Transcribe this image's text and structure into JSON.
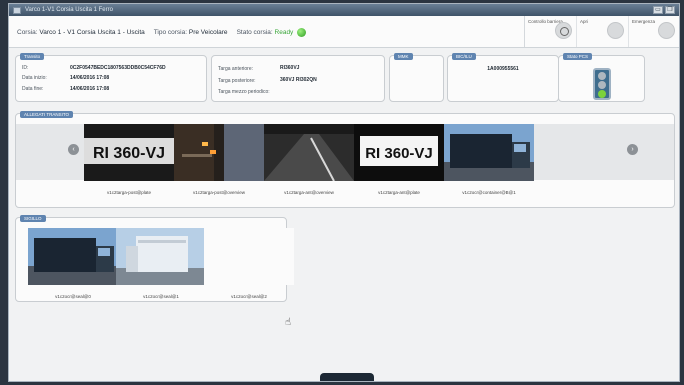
{
  "window": {
    "title": "Varco 1-V1 Corsia Uscita 1 Ferro",
    "min_icon": "minimize-icon",
    "max_icon": "maximize-icon",
    "min_glyph": "▭",
    "max_glyph": "❐"
  },
  "header": {
    "corsia_label": "Corsia:",
    "corsia_value": "Varco 1 - V1 Corsia Uscita 1 - Uscita",
    "tipo_label": "Tipo corsia:",
    "tipo_value": "Pre Veicolare",
    "stato_label": "Stato corsia:",
    "stato_value": "Ready",
    "stato_color": "#3aa63a",
    "controls": [
      {
        "label": "Controllo barriera"
      },
      {
        "label": "Apri"
      },
      {
        "label": "Emergenza"
      }
    ]
  },
  "transito": {
    "tag": "Transito",
    "id_label": "ID:",
    "id_value": "0C2F0547BEDC1807563DDB0C54CF76D",
    "inizio_label": "Data inizio:",
    "inizio_value": "14/06/2016 17:08",
    "fine_label": "Data fine:",
    "fine_value": "14/06/2016 17:08"
  },
  "targhe": {
    "anteriore_label": "Targa anteriore:",
    "anteriore_value": "RI360VJ",
    "posteriore_label": "Targa posteriore:",
    "posteriore_value": "360VJ RI302QN",
    "periodico_label": "Targa mezzo periodico:",
    "periodico_value": ""
  },
  "mmk": {
    "tag": "MMK"
  },
  "bic": {
    "tag": "BIC/ILU",
    "value": "1A000955561"
  },
  "stato_pcs": {
    "tag": "Stato PCS",
    "lamp_color": "#7cd23c"
  },
  "allegati": {
    "tag": "ALLEGATI TRANSITO",
    "nav_prev": "‹",
    "nav_next": "›",
    "images": [
      {
        "caption": "v1c2targa-post@plate",
        "kind": "plate-dark",
        "plate_text": "RI 360-VJ"
      },
      {
        "caption": "v1c2targa-post@overview",
        "kind": "tunnel"
      },
      {
        "caption": "v1c2targa-ant@overview",
        "kind": "road"
      },
      {
        "caption": "v1c2targa-ant@plate",
        "kind": "plate-white",
        "plate_text": "RI 360-VJ"
      },
      {
        "caption": "v1c2ocr@container@B@1",
        "kind": "truck-blue"
      }
    ]
  },
  "sigilli": {
    "tag": "SIGILLO",
    "images": [
      {
        "caption": "v1c2ocr@seal@0",
        "kind": "truck-blue"
      },
      {
        "caption": "v1c2ocr@seal@1",
        "kind": "truck-white"
      },
      {
        "caption": "v1c2ocr@seal@2",
        "kind": "empty"
      }
    ]
  },
  "colors": {
    "tag_blue": "#5f84b0",
    "accent": "#3aa63a"
  },
  "cursor": "☝"
}
